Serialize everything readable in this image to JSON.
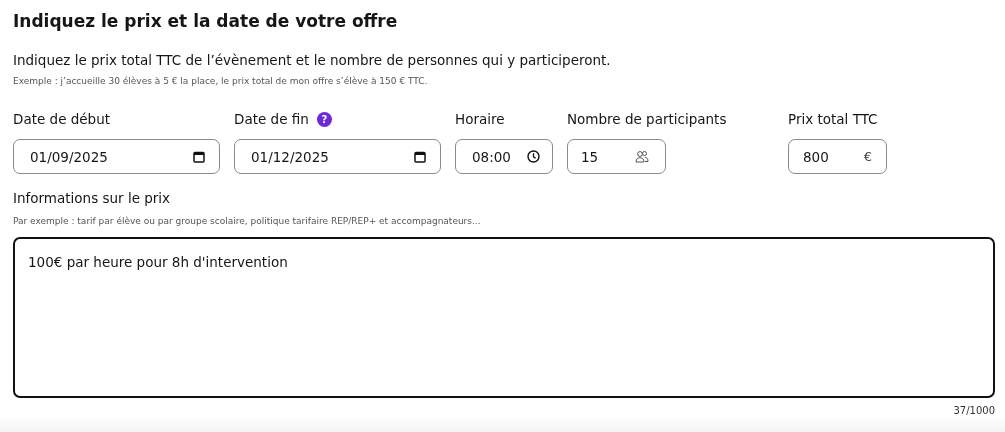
{
  "title": "Indiquez le prix et la date de votre offre",
  "description": "Indiquez le prix total TTC de l’évènement et le nombre de personnes qui y participeront.",
  "example": "Exemple : j’accueille 30 élèves à 5 € la place, le prix total de mon offre s’élève à 150 € TTC.",
  "fields": [
    {
      "label": "Date de début",
      "value": "01/09/2025",
      "kind": "date",
      "help": false
    },
    {
      "label": "Date de fin",
      "value": "01/12/2025",
      "kind": "date",
      "help": true,
      "help_text": "?"
    },
    {
      "label": "Horaire",
      "value": "08:00",
      "kind": "time",
      "help": false
    },
    {
      "label": "Nombre de participants",
      "value": "15",
      "kind": "people",
      "help": false
    },
    {
      "label": "Prix total TTC",
      "value": "800",
      "kind": "currency",
      "help": false,
      "suffix": "€"
    }
  ],
  "price_info": {
    "label": "Informations sur le prix",
    "hint": "Par exemple : tarif par élève ou par groupe scolaire, politique tarifaire REP/REP+ et accompagnateurs...",
    "value": "100€ par heure pour 8h d'intervention",
    "counter": "37/1000"
  }
}
